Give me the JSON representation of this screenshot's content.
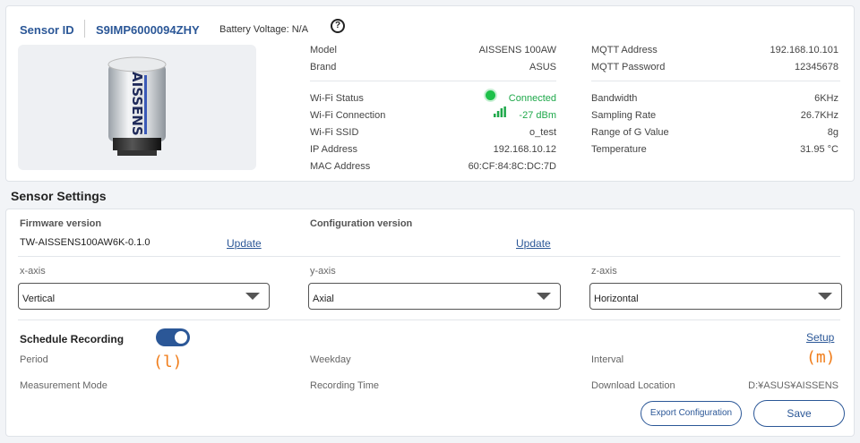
{
  "header": {
    "sensor_id_label": "Sensor ID",
    "sensor_id_value": "S9IMP6000094ZHY",
    "battery": "Battery Voltage: N/A",
    "help_icon": "?"
  },
  "product": {
    "brand_text": "AISSENS"
  },
  "info_left": [
    {
      "label": "Model",
      "value": "AISSENS 100AW"
    },
    {
      "label": "Brand",
      "value": "ASUS"
    }
  ],
  "info_right": [
    {
      "label": "MQTT Address",
      "value": "192.168.10.101"
    },
    {
      "label": "MQTT Password",
      "value": "12345678"
    }
  ],
  "wifi": [
    {
      "label": "Wi-Fi Status",
      "value": "Connected"
    },
    {
      "label": "Wi-Fi Connection",
      "value": "-27 dBm"
    },
    {
      "label": "Wi-Fi SSID",
      "value": "o_test"
    },
    {
      "label": "IP Address",
      "value": "192.168.10.12"
    },
    {
      "label": "MAC Address",
      "value": "60:CF:84:8C:DC:7D"
    }
  ],
  "signal": [
    {
      "label": "Bandwidth",
      "value": "6KHz"
    },
    {
      "label": "Sampling Rate",
      "value": "26.7KHz"
    },
    {
      "label": "Range of G Value",
      "value": "8g"
    },
    {
      "label": "Temperature",
      "value": "31.95 °C"
    }
  ],
  "settings": {
    "title": "Sensor Settings",
    "firmware_label": "Firmware version",
    "firmware_value": "TW-AISSENS100AW6K-0.1.0",
    "firmware_update": "Update",
    "config_label": "Configuration version",
    "config_update": "Update",
    "axes": [
      {
        "label": "x-axis",
        "value": "Vertical"
      },
      {
        "label": "y-axis",
        "value": "Axial"
      },
      {
        "label": "z-axis",
        "value": "Horizontal"
      }
    ],
    "schedule_label": "Schedule Recording",
    "schedule_on": true,
    "setup": "Setup",
    "marker_l": "(l)",
    "marker_m": "(m)",
    "period": "Period",
    "weekday": "Weekday",
    "interval": "Interval",
    "measurement_mode": "Measurement Mode",
    "recording_time": "Recording Time",
    "download_location_label": "Download Location",
    "download_location_value": "D:¥ASUS¥AISSENS",
    "export_button": "Export Configuration",
    "save_button": "Save"
  },
  "colors": {
    "accent": "#2b5797",
    "connected": "#1ea84a",
    "marker": "#f07d1a"
  }
}
